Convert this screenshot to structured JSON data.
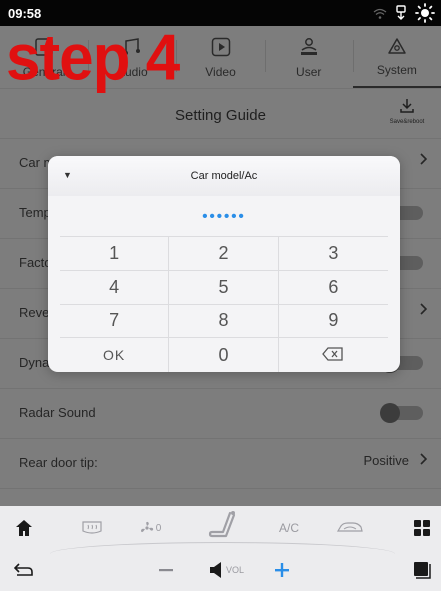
{
  "status_bar": {
    "time": "09:58"
  },
  "overlay": {
    "step_text": "step 4"
  },
  "tabs": [
    {
      "label": "General",
      "icon": "general-icon"
    },
    {
      "label": "Audio",
      "icon": "audio-icon"
    },
    {
      "label": "Video",
      "icon": "video-icon"
    },
    {
      "label": "User",
      "icon": "user-icon"
    },
    {
      "label": "System",
      "icon": "system-icon",
      "active": true
    }
  ],
  "header": {
    "title": "Setting Guide",
    "save_label": "Save&reboot"
  },
  "rows": [
    {
      "label": "Car m",
      "control": "chevron"
    },
    {
      "label": "Temp",
      "control": "toggle"
    },
    {
      "label": "Facto",
      "control": "toggle"
    },
    {
      "label": "Rever",
      "control": "chevron"
    },
    {
      "label": "Dyna",
      "control": "toggle"
    },
    {
      "label": "Radar Sound",
      "control": "toggle"
    },
    {
      "label": "Rear door tip:",
      "control": "chevron",
      "value": "Positive"
    }
  ],
  "dialog": {
    "title": "Car model/Ac",
    "password_display": "••••••",
    "keys": [
      "1",
      "2",
      "3",
      "4",
      "5",
      "6",
      "7",
      "8",
      "9",
      "OK",
      "0",
      "backspace"
    ]
  },
  "bottom_bar": {
    "ac_label": "A/C",
    "fan_level": "0",
    "vol_label": "VOL"
  },
  "colors": {
    "accent": "#2a8ee8",
    "overlay_text": "#e01010"
  }
}
